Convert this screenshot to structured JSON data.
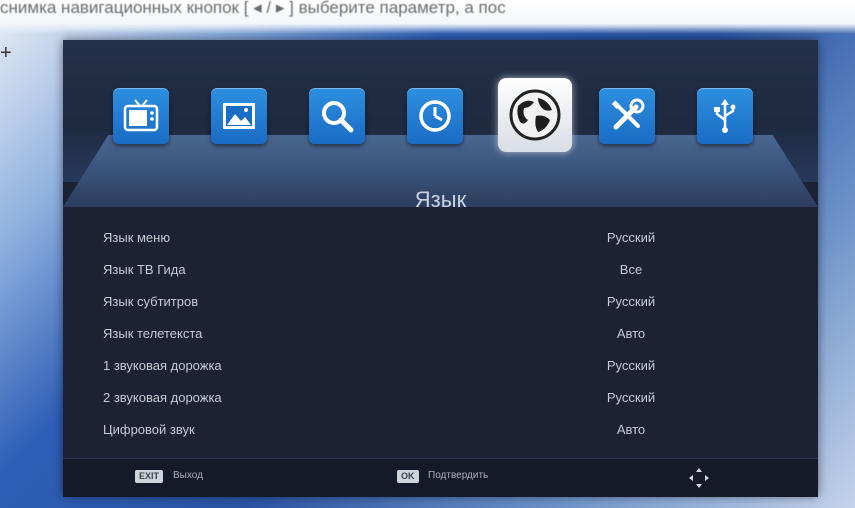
{
  "top_caption": "снимка навигационных кнопок [ ◂ / ▸ ] выберите параметр, а пос",
  "plus_mark": "+",
  "menu": {
    "icons": [
      {
        "name": "tv-icon",
        "active": false
      },
      {
        "name": "image-icon",
        "active": false
      },
      {
        "name": "search-icon",
        "active": false
      },
      {
        "name": "clock-icon",
        "active": false
      },
      {
        "name": "globe-icon",
        "active": true
      },
      {
        "name": "tools-icon",
        "active": false
      },
      {
        "name": "usb-icon",
        "active": false
      }
    ]
  },
  "page_title": "Язык",
  "rows": [
    {
      "label": "Язык меню",
      "value": "Русский"
    },
    {
      "label": "Язык ТВ Гида",
      "value": "Все"
    },
    {
      "label": "Язык субтитров",
      "value": "Русский"
    },
    {
      "label": "Язык телетекста",
      "value": "Авто"
    },
    {
      "label": "1 звуковая дорожка",
      "value": "Русский"
    },
    {
      "label": "2 звуковая дорожка",
      "value": "Русский"
    },
    {
      "label": "Цифровой звук",
      "value": "Авто"
    }
  ],
  "footer": {
    "exit_key": "EXIT",
    "exit_label": "Выход",
    "ok_key": "OK",
    "ok_label": "Подтвердить"
  },
  "colors": {
    "icon_blue": "#1f7bd3",
    "screen_bg": "#1b2233",
    "text": "#c4cad6"
  }
}
